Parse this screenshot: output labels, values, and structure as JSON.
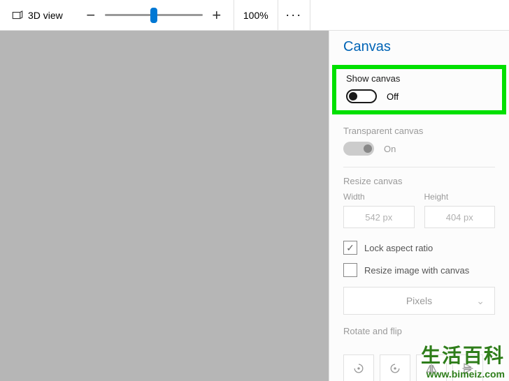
{
  "topbar": {
    "view_label": "3D view",
    "zoom_level": "100%"
  },
  "panel": {
    "title": "Canvas",
    "show_canvas": {
      "label": "Show canvas",
      "state_text": "Off"
    },
    "transparent_canvas": {
      "label": "Transparent canvas",
      "state_text": "On"
    },
    "resize": {
      "label": "Resize canvas",
      "width_label": "Width",
      "height_label": "Height",
      "width_value": "542 px",
      "height_value": "404 px"
    },
    "lock_aspect": {
      "label": "Lock aspect ratio",
      "checked": true
    },
    "resize_image": {
      "label": "Resize image with canvas",
      "checked": false
    },
    "unit": {
      "value": "Pixels"
    },
    "rotate_flip": {
      "label": "Rotate and flip"
    }
  },
  "watermark": {
    "text": "生活百科",
    "url": "www.bimeiz.com"
  }
}
